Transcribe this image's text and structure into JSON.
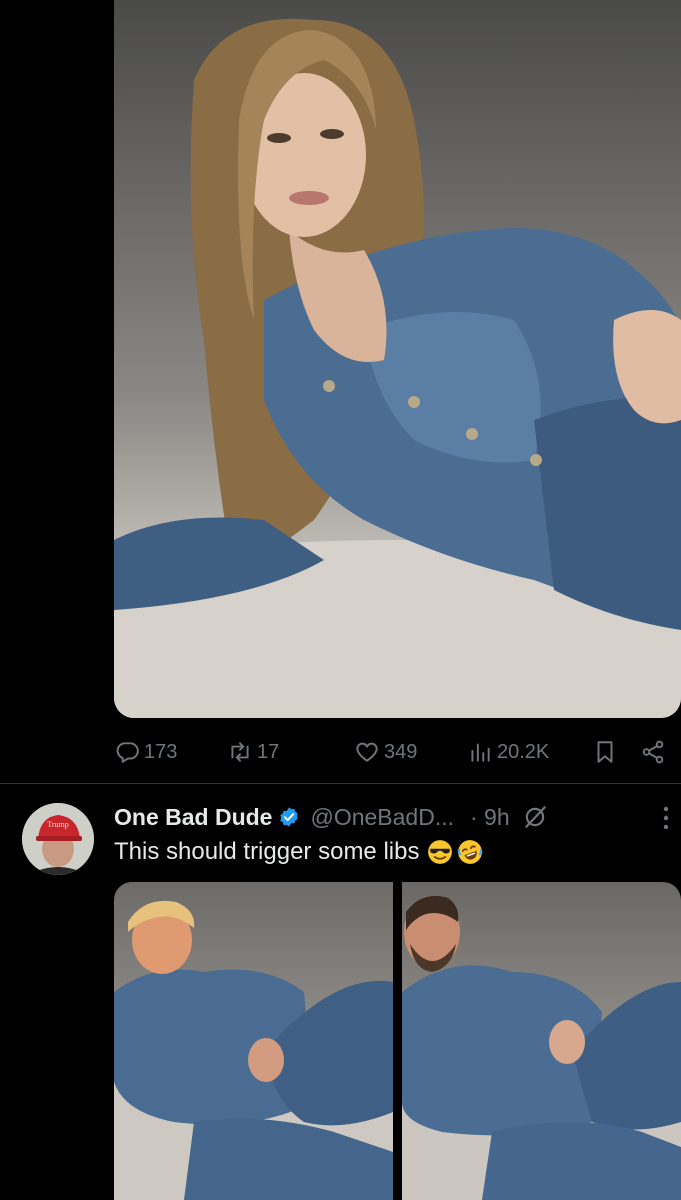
{
  "post1": {
    "media_alt": "photo",
    "stats": {
      "replies": "173",
      "reposts": "17",
      "likes": "349",
      "views": "20.2K"
    }
  },
  "post2": {
    "display_name": "One Bad Dude",
    "handle": "@OneBadD...",
    "time": "· 9h",
    "text": "This should trigger some libs",
    "avatar_hat_text": "Trump",
    "verified_color": "#1d9bf0"
  },
  "colors": {
    "background": "#000000",
    "text_primary": "#e7e9ea",
    "text_secondary": "#71767b",
    "accent": "#1d9bf0"
  },
  "icons": [
    "reply-icon",
    "repost-icon",
    "like-icon",
    "views-icon",
    "bookmark-icon",
    "share-icon",
    "verified-icon",
    "grok-icon",
    "more-icon"
  ]
}
